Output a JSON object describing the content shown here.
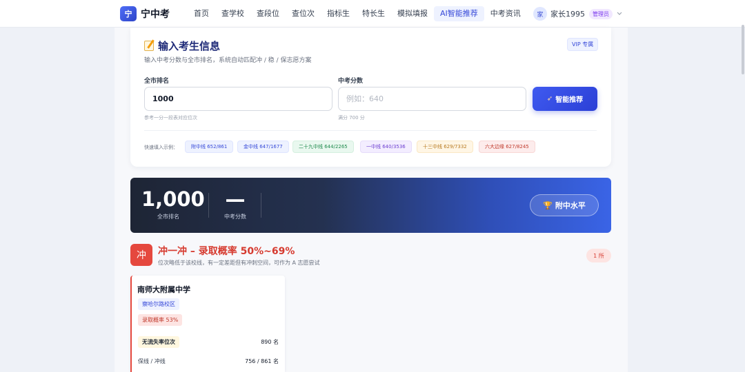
{
  "brand": {
    "logo_char": "宁",
    "name": "宁中考"
  },
  "nav": {
    "items": [
      {
        "label": "首页"
      },
      {
        "label": "查学校"
      },
      {
        "label": "查段位"
      },
      {
        "label": "查位次"
      },
      {
        "label": "指标生"
      },
      {
        "label": "特长生"
      },
      {
        "label": "模拟填报"
      },
      {
        "label": "AI智能推荐",
        "active": true
      },
      {
        "label": "中考资讯"
      }
    ]
  },
  "user": {
    "avatar_char": "家",
    "name": "家长1995",
    "role": "管理员"
  },
  "form": {
    "title": "输入考生信息",
    "subtitle": "输入中考分数与全市排名，系统自动匹配冲 / 稳 / 保志愿方案",
    "vip": "VIP 专属",
    "rank_label": "全市排名",
    "rank_value": "1000",
    "rank_hint": "参考一分一段表对应位次",
    "score_label": "中考分数",
    "score_placeholder": "例如：640",
    "score_hint": "满分 700 分",
    "submit": "智能推荐",
    "quick_label": "快速填入示例：",
    "examples": [
      {
        "label": "附中线 652/861",
        "color": "#eef2ff",
        "text": "#3548d8",
        "border": "#dfe5ff"
      },
      {
        "label": "金中线 647/1677",
        "color": "#eef2ff",
        "text": "#3548d8",
        "border": "#dfe5ff"
      },
      {
        "label": "二十九中线 644/2265",
        "color": "#e9f8ef",
        "text": "#1f8a4c",
        "border": "#d5f0df"
      },
      {
        "label": "一中线 640/3536",
        "color": "#f3edff",
        "text": "#6d3fd1",
        "border": "#e6dcfb"
      },
      {
        "label": "十三中线 629/7332",
        "color": "#fff6e5",
        "text": "#b7791f",
        "border": "#fbe8c4"
      },
      {
        "label": "六大边缘 627/8245",
        "color": "#fdecec",
        "text": "#c0392b",
        "border": "#f8d7d5"
      }
    ]
  },
  "banner": {
    "rank": "1,000",
    "rank_caption": "全市排名",
    "score": "—",
    "score_caption": "中考分数",
    "level": "附中水平"
  },
  "section": {
    "icon_char": "冲",
    "title": "冲一冲 – 录取概率 50%~69%",
    "subtitle": "位次略低于该校线，有一定差距但有冲刺空间，可作为 A 志愿尝试",
    "count": "1 所",
    "school": {
      "name": "南师大附属中学",
      "campus": "察哈尔路校区",
      "probability": "录取概率 53%",
      "rows": [
        {
          "key": "无流失率位次",
          "value": "890 名"
        },
        {
          "key": "保线 / 冲线",
          "value": "756 / 861 名"
        }
      ]
    }
  }
}
